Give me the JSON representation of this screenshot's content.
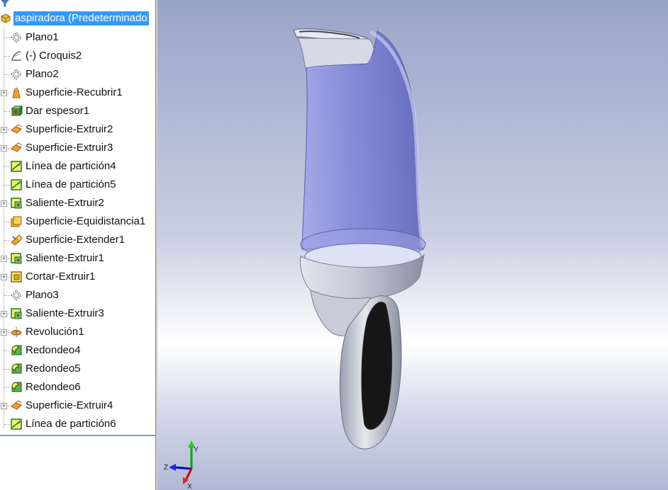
{
  "feature_tree": {
    "root_label": "aspiradora  (Predeterminado",
    "items": [
      {
        "label": "Plano1",
        "icon": "plane-icon",
        "expandable": false
      },
      {
        "label": "(-) Croquis2",
        "icon": "sketch-icon",
        "expandable": false
      },
      {
        "label": "Plano2",
        "icon": "plane-icon",
        "expandable": false
      },
      {
        "label": "Superficie-Recubrir1",
        "icon": "surface-loft-icon",
        "expandable": true
      },
      {
        "label": "Dar espesor1",
        "icon": "thicken-icon",
        "expandable": false
      },
      {
        "label": "Superficie-Extruir2",
        "icon": "surface-extrude-icon",
        "expandable": true
      },
      {
        "label": "Superficie-Extruir3",
        "icon": "surface-extrude-icon",
        "expandable": true
      },
      {
        "label": "Línea de partición4",
        "icon": "split-line-icon",
        "expandable": false
      },
      {
        "label": "Línea de partición5",
        "icon": "split-line-icon",
        "expandable": false
      },
      {
        "label": "Saliente-Extruir2",
        "icon": "boss-extrude-icon",
        "expandable": true
      },
      {
        "label": "Superficie-Equidistancia1",
        "icon": "offset-surface-icon",
        "expandable": false
      },
      {
        "label": "Superficie-Extender1",
        "icon": "extend-surface-icon",
        "expandable": false
      },
      {
        "label": "Saliente-Extruir1",
        "icon": "boss-extrude-icon",
        "expandable": true
      },
      {
        "label": "Cortar-Extruir1",
        "icon": "cut-extrude-icon",
        "expandable": true
      },
      {
        "label": "Plano3",
        "icon": "plane-icon",
        "expandable": false
      },
      {
        "label": "Saliente-Extruir3",
        "icon": "boss-extrude-icon",
        "expandable": true
      },
      {
        "label": "Revolución1",
        "icon": "revolve-icon",
        "expandable": true
      },
      {
        "label": "Redondeo4",
        "icon": "fillet-icon",
        "expandable": false
      },
      {
        "label": "Redondeo5",
        "icon": "fillet-icon",
        "expandable": false
      },
      {
        "label": "Redondeo6",
        "icon": "fillet-icon",
        "expandable": false
      },
      {
        "label": "Superficie-Extruir4",
        "icon": "surface-extrude-icon",
        "expandable": true
      },
      {
        "label": "Línea de partición6",
        "icon": "split-line-icon",
        "expandable": false
      }
    ]
  },
  "triad": {
    "x_label": "X",
    "y_label": "Y",
    "z_label": "Z",
    "colors": {
      "x": "#cc0000",
      "y": "#00aa00",
      "z": "#0000cc"
    }
  },
  "colors": {
    "selection": "#3399ff",
    "transparent_body": "#7a7fd8",
    "solid_body": "#c4c8d6"
  }
}
